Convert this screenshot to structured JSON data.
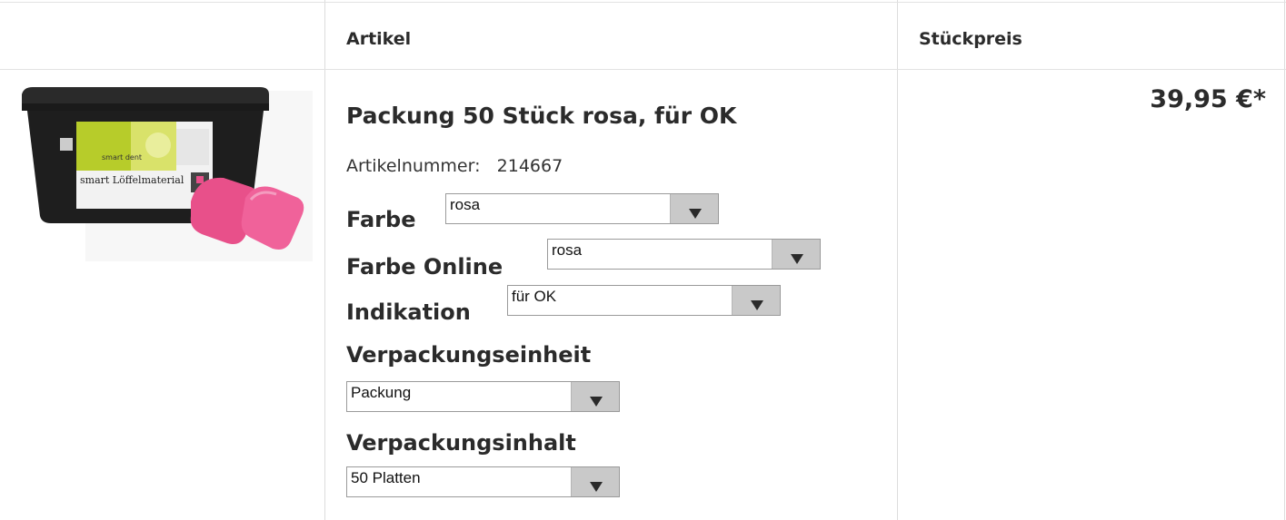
{
  "header": {
    "col_article": "Artikel",
    "col_unit_price": "Stückpreis"
  },
  "product": {
    "image_alt": "smart Löffelmaterial",
    "image_brand_text": "smart dent",
    "image_label_text": "smart Löffelmaterial",
    "title": "Packung 50 Stück rosa, für OK",
    "article_number_label": "Artikelnummer:",
    "article_number": "214667",
    "price": "39,95 €*"
  },
  "options": {
    "farbe": {
      "label": "Farbe",
      "value": "rosa"
    },
    "farbe_online": {
      "label": "Farbe Online",
      "value": "rosa"
    },
    "indikation": {
      "label": "Indikation",
      "value": "für OK"
    },
    "verpackungseinheit": {
      "label": "Verpackungseinheit",
      "value": "Packung"
    },
    "verpackungsinhalt": {
      "label": "Verpackungsinhalt",
      "value": "50 Platten"
    }
  },
  "colors": {
    "border": "#dcdcdc",
    "text": "#2b2b2b",
    "select_arrow_bg": "#c9c9c9",
    "product_pink": "#e8508a",
    "bucket_black": "#1e1e1e",
    "label_green": "#b7cc2a"
  }
}
